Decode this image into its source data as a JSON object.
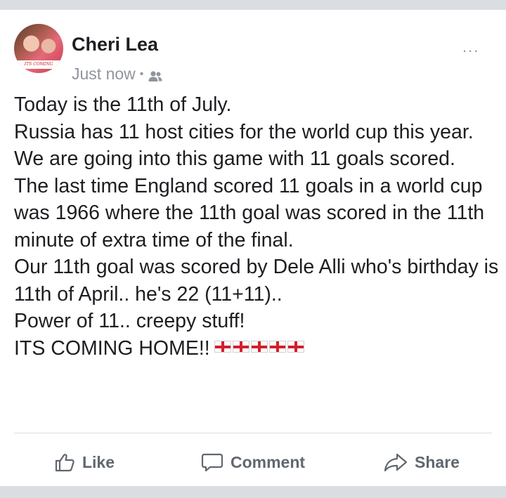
{
  "post": {
    "author": "Cheri Lea",
    "timestamp": "Just now",
    "separator": "•",
    "audience_icon": "friends-icon",
    "more_label": "...",
    "avatar_banner": "ITS COMING",
    "lines": [
      "Today is the 11th of July.",
      "Russia has 11 host cities for the world cup this year.",
      "We are going into this game with 11 goals scored.",
      "The last time England scored 11 goals in a world cup was 1966 where the 11th goal was scored in the 11th minute of extra time of the final.",
      "Our 11th goal was scored by Dele Alli who's birthday is 11th of April.. he's 22 (11+11)..",
      "Power of 11.. creepy stuff!",
      "ITS COMING HOME!!"
    ],
    "flag_count": 5,
    "flag_icon": "england-flag-icon"
  },
  "actions": {
    "like": "Like",
    "comment": "Comment",
    "share": "Share"
  }
}
